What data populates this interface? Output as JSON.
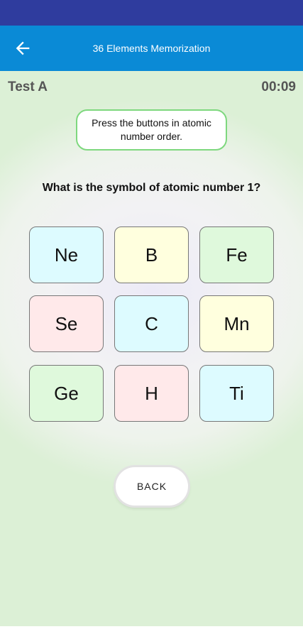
{
  "app_bar": {
    "title": "36 Elements Memorization"
  },
  "header": {
    "test_label": "Test A",
    "timer": "00:09"
  },
  "hint": {
    "text": "Press the buttons in atomic number order."
  },
  "question": {
    "text": "What is the symbol of atomic number 1?"
  },
  "elements": [
    {
      "symbol": "Ne",
      "color": "#ddfbff"
    },
    {
      "symbol": "B",
      "color": "#ffffde"
    },
    {
      "symbol": "Fe",
      "color": "#dff9dc"
    },
    {
      "symbol": "Se",
      "color": "#ffe9ea"
    },
    {
      "symbol": "C",
      "color": "#ddfbff"
    },
    {
      "symbol": "Mn",
      "color": "#ffffde"
    },
    {
      "symbol": "Ge",
      "color": "#dff9dc"
    },
    {
      "symbol": "H",
      "color": "#ffe9ea"
    },
    {
      "symbol": "Ti",
      "color": "#ddfbff"
    }
  ],
  "back_button": {
    "label": "BACK"
  },
  "colors": {
    "status_bar": "#2f3c9e",
    "app_bar": "#0a8ad6",
    "hint_border": "#7ed87e"
  }
}
